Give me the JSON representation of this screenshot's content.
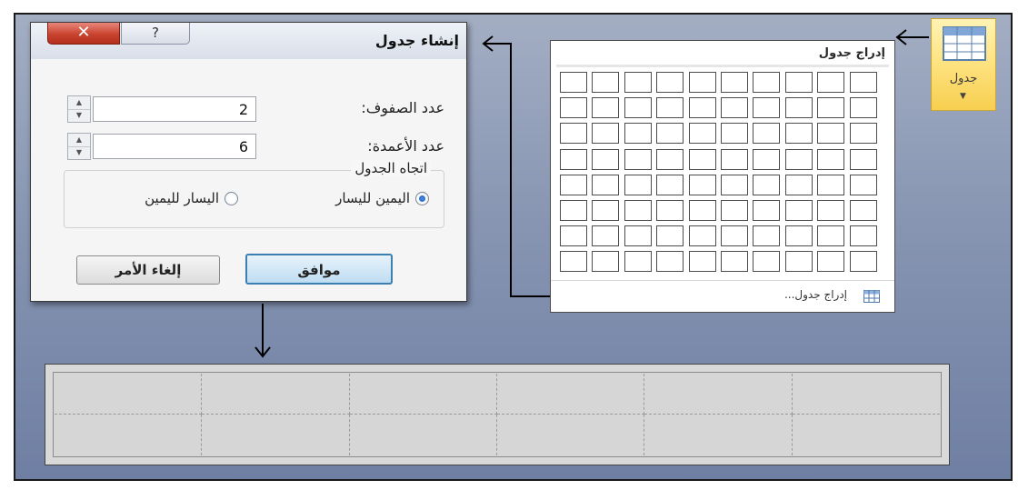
{
  "ribbon": {
    "table_button_label": "جدول",
    "table_icon": "table-grid-icon",
    "dropdown_icon": "chevron-down-icon"
  },
  "insert_table_menu": {
    "header": "إدراج جدول",
    "grid": {
      "columns": 10,
      "rows": 8
    },
    "footer_item": "إدراج جدول...",
    "footer_icon": "table-grid-icon"
  },
  "dialog": {
    "title": "إنشاء جدول",
    "close_icon": "close-icon",
    "help_icon": "help-icon",
    "rows_label": "عدد الصفوف:",
    "rows_value": "2",
    "columns_label": "عدد الأعمدة:",
    "columns_value": "6",
    "direction_group_label": "اتجاه الجدول",
    "option_rtl": "اليمين لليسار",
    "option_ltr": "اليسار لليمين",
    "selected_direction": "rtl",
    "ok_label": "موافق",
    "cancel_label": "إلغاء الأمر"
  },
  "result_table": {
    "rows": 2,
    "columns": 6
  },
  "colors": {
    "accent": "#3c7fb1",
    "ribbon_highlight": "#fde07a",
    "close_red": "#c9442f",
    "background": "#8795b2"
  }
}
